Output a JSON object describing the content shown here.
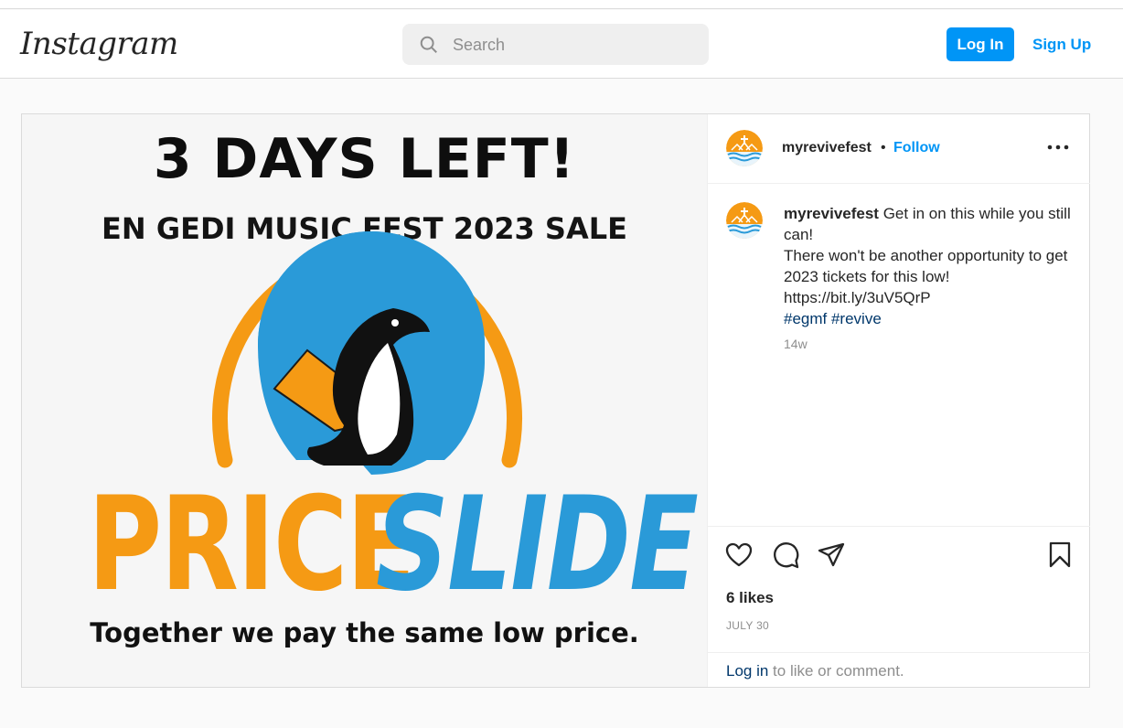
{
  "header": {
    "logo_text": "Instagram",
    "search_placeholder": "Search",
    "login_label": "Log In",
    "signup_label": "Sign Up"
  },
  "post": {
    "image": {
      "headline": "3 DAYS LEFT!",
      "subheadline": "EN GEDI MUSIC FEST 2023 SALE",
      "word_price": "PRICE",
      "word_slide": "SLIDE",
      "tagline": "Together we pay the same low price."
    },
    "author": {
      "username": "myrevivefest",
      "dot": "•",
      "follow_label": "Follow"
    },
    "caption": {
      "username": "myrevivefest",
      "line1": " Get in on this while you still can!",
      "line2": "There won't be another opportunity to get 2023 tickets for this low!",
      "line3": "https://bit.ly/3uV5QrP",
      "hashtags": "#egmf #revive",
      "age": "14w"
    },
    "likes_text": "6 likes",
    "date_text": "JULY 30",
    "login_prompt": {
      "link": "Log in",
      "rest": " to like or comment."
    }
  },
  "colors": {
    "accent": "#0095f6",
    "orange": "#f59a14",
    "blue": "#2a9ad8"
  }
}
